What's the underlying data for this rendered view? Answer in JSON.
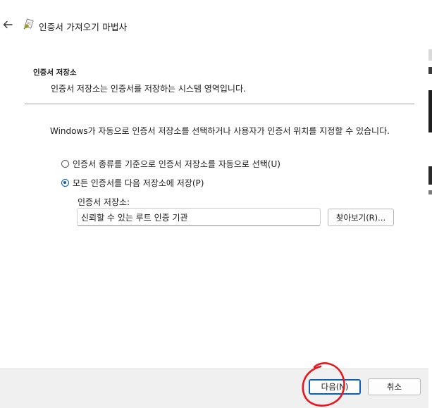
{
  "window": {
    "title": "인증서 가져오기 마법사"
  },
  "icons": {
    "back": "back-arrow-icon",
    "wizard": "certificate-icon"
  },
  "section": {
    "heading": "인증서 저장소",
    "description": "인증서 저장소는 인증서를 저장하는 시스템 영역입니다."
  },
  "intro_text": "Windows가 자동으로 인증서 저장소를 선택하거나 사용자가 인증서 위치를 지정할 수 있습니다.",
  "options": {
    "auto": {
      "label": "인증서 종류를 기준으로 인증서 저장소를 자동으로 선택(U)",
      "selected": false
    },
    "manual": {
      "label": "모든 인증서를 다음 저장소에 저장(P)",
      "selected": true
    }
  },
  "store": {
    "label": "인증서 저장소:",
    "value": "신뢰할 수 있는 루트 인증 기관",
    "browse_label": "찾아보기(R)..."
  },
  "footer": {
    "next_label": "다음(N)",
    "cancel_label": "취소"
  },
  "colors": {
    "accent": "#0a5fb4",
    "annotation": "#e8161f",
    "footer_bg": "#f0f0f0"
  }
}
